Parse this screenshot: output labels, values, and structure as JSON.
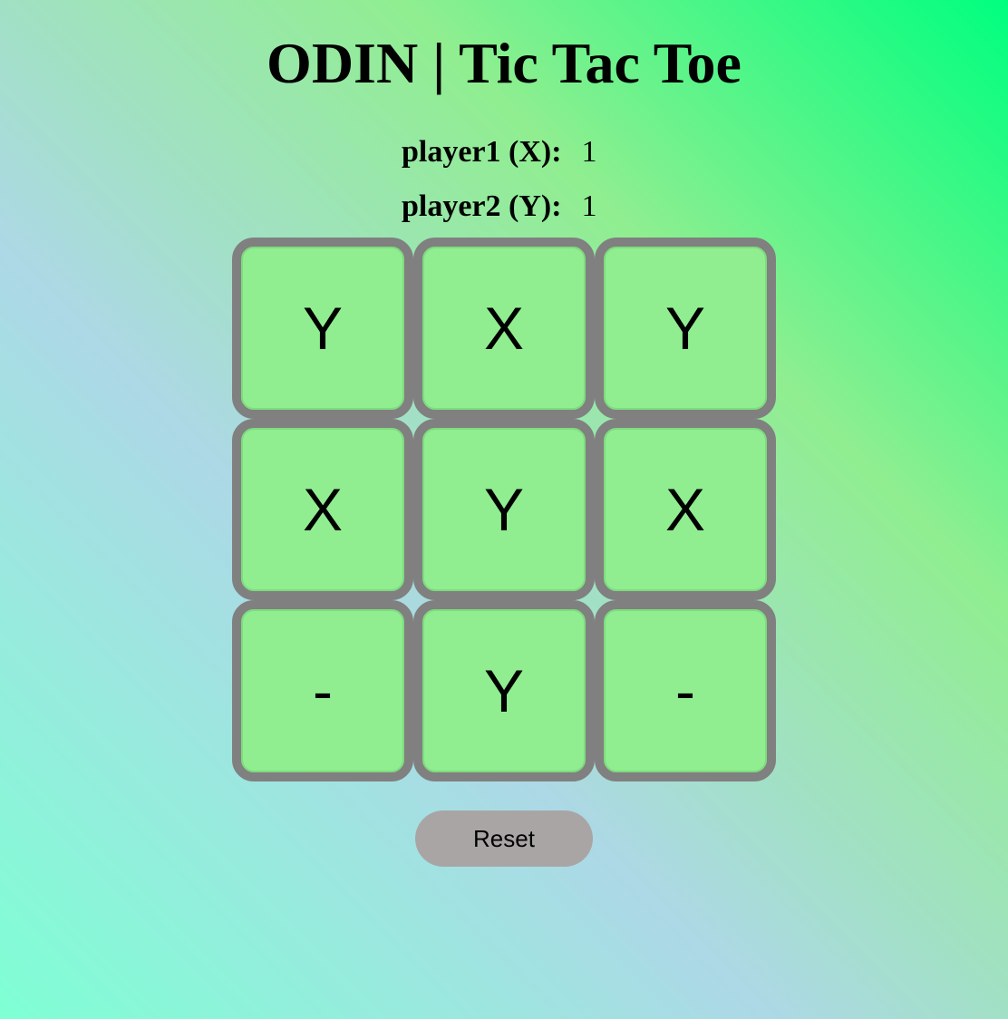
{
  "header": {
    "title": "ODIN | Tic Tac Toe"
  },
  "scoreboard": {
    "player1": {
      "label": "player1 (X):",
      "score": "1"
    },
    "player2": {
      "label": "player2 (Y):",
      "score": "1"
    }
  },
  "board": {
    "cells": [
      "Y",
      "X",
      "Y",
      "X",
      "Y",
      "X",
      "-",
      "Y",
      "-"
    ]
  },
  "controls": {
    "reset_label": "Reset"
  },
  "colors": {
    "cell_background": "#90ee90",
    "cell_border": "#808080",
    "reset_background": "#a9a5a5"
  }
}
